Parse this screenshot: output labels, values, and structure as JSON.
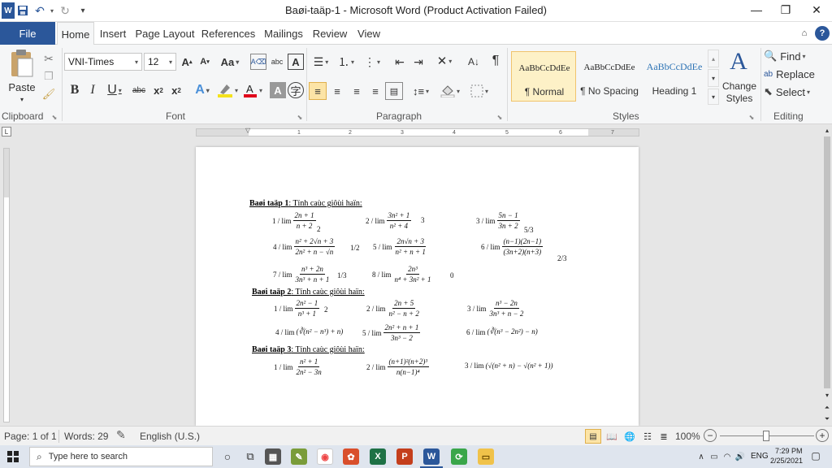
{
  "window": {
    "title": "Baøi-taäp-1  -  Microsoft Word (Product Activation Failed)",
    "minimize": "—",
    "maximize": "❐",
    "close": "✕"
  },
  "qat": {
    "save_icon": "save-icon",
    "undo_icon": "undo-icon",
    "redo_icon": "redo-icon"
  },
  "tabs": {
    "file": "File",
    "items": [
      "Home",
      "Insert",
      "Page Layout",
      "References",
      "Mailings",
      "Review",
      "View"
    ]
  },
  "ribbon": {
    "clipboard": {
      "paste": "Paste",
      "label": "Clipboard"
    },
    "font": {
      "name": "VNI-Times",
      "size": "12",
      "label": "Font"
    },
    "paragraph": {
      "label": "Paragraph"
    },
    "styles": {
      "label": "Styles",
      "cards": [
        {
          "preview": "AaBbCcDdEe",
          "name": "¶ Normal"
        },
        {
          "preview": "AaBbCcDdEe",
          "name": "¶ No Spacing"
        },
        {
          "preview": "AaBbCcDdEe",
          "name": "Heading 1"
        }
      ],
      "change": "Change Styles"
    },
    "editing": {
      "label": "Editing",
      "find": "Find",
      "replace": "Replace",
      "select": "Select"
    }
  },
  "ruler": {
    "numbers": [
      "1",
      "1",
      "2",
      "3",
      "4",
      "5",
      "6",
      "7"
    ]
  },
  "document": {
    "heading1": {
      "bold": "Baøi taäp 1",
      "rest": ":  Tính caùc giôùi haïn:"
    },
    "heading2": {
      "bold": "Baøi taäp 2",
      "rest": ":  Tính caùc giôùi haïn:"
    },
    "heading3": {
      "bold": "Baøi taäp 3",
      "rest": ":  Tính caùc giôùi haïn:"
    },
    "p1": [
      {
        "label": "1 / lim",
        "num": "2n + 1",
        "den": "n + 2",
        "ans": "2"
      },
      {
        "label": "2 / lim",
        "num": "3n² + 1",
        "den": "n² + 4",
        "ans": "3"
      },
      {
        "label": "3 / lim",
        "num": "5n − 1",
        "den": "3n + 2",
        "ans": "5/3"
      },
      {
        "label": "4 / lim",
        "num": "n² + 2√n + 3",
        "den": "2n² + n − √n",
        "ans": "1/2"
      },
      {
        "label": "5 / lim",
        "num": "2n√n + 3",
        "den": "n² + n + 1",
        "ans": ""
      },
      {
        "label": "6 / lim",
        "num": "(n−1)(2n−1)",
        "den": "(3n+2)(n+3)",
        "ans": "2/3"
      },
      {
        "label": "7 / lim",
        "num": "n³ + 2n",
        "den": "3n³ + n + 1",
        "ans": "1/3"
      },
      {
        "label": "8 / lim",
        "num": "2n³",
        "den": "n⁴ + 3n² + 1",
        "ans": "0"
      }
    ],
    "p2": [
      {
        "label": "1 / lim",
        "num": "2n² − 1",
        "den": "n³ + 1",
        "ans": "2"
      },
      {
        "label": "2 / lim",
        "num": "2n + 5",
        "den": "n² − n + 2",
        "ans": ""
      },
      {
        "label": "3 / lim",
        "num": "n³ − 2n",
        "den": "3n³ + n − 2",
        "ans": ""
      },
      {
        "label": "4 / lim",
        "expr": "(∛(n² − n³) + n)"
      },
      {
        "label": "5 / lim",
        "num": "2n² + n + 1",
        "den": "3n³ − 2",
        "ans": ""
      },
      {
        "label": "6 / lim",
        "expr": "(∛(n³ − 2n²) − n)"
      }
    ],
    "p3": [
      {
        "label": "1 / lim",
        "num": "n² + 1",
        "den": "2n² − 3n"
      },
      {
        "label": "2 / lim",
        "num": "(n+1)²(n+2)³",
        "den": "n(n−1)⁴"
      },
      {
        "label": "3 / lim",
        "expr": "(√(n² + n) − √(n² + 1))"
      }
    ]
  },
  "status": {
    "page": "Page: 1 of 1",
    "words": "Words: 29",
    "language": "English (U.S.)",
    "zoom": "100%"
  },
  "taskbar": {
    "search_placeholder": "Type here to search",
    "lang": "ENG",
    "time": "7:29 PM",
    "date": "2/25/2021"
  }
}
